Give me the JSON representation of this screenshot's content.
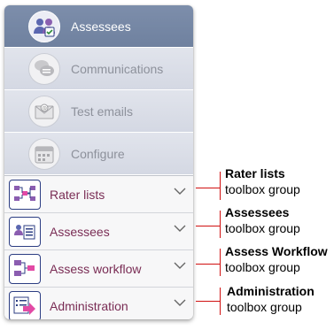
{
  "nav": {
    "items": [
      {
        "label": "Assessees",
        "icon": "assessees-icon",
        "active": true
      },
      {
        "label": "Communications",
        "icon": "communications-icon",
        "active": false
      },
      {
        "label": "Test emails",
        "icon": "test-emails-icon",
        "active": false
      },
      {
        "label": "Configure",
        "icon": "configure-icon",
        "active": false
      }
    ]
  },
  "groups": [
    {
      "label": "Rater lists",
      "icon": "rater-lists-icon"
    },
    {
      "label": "Assessees",
      "icon": "assessees-list-icon"
    },
    {
      "label": "Assess workflow",
      "icon": "workflow-icon"
    },
    {
      "label": "Administration",
      "icon": "administration-icon"
    }
  ],
  "callouts": [
    {
      "title": "Rater lists",
      "subtitle": "toolbox group"
    },
    {
      "title": "Assessees",
      "subtitle": "toolbox group"
    },
    {
      "title": "Assess Workflow",
      "subtitle": "toolbox group"
    },
    {
      "title": "Administration",
      "subtitle": "toolbox group"
    }
  ],
  "colors": {
    "active_bg": "#7d8eab",
    "nav_bg": "#d8dce5",
    "group_label": "#7a2d55",
    "callout_line": "#d01010"
  }
}
